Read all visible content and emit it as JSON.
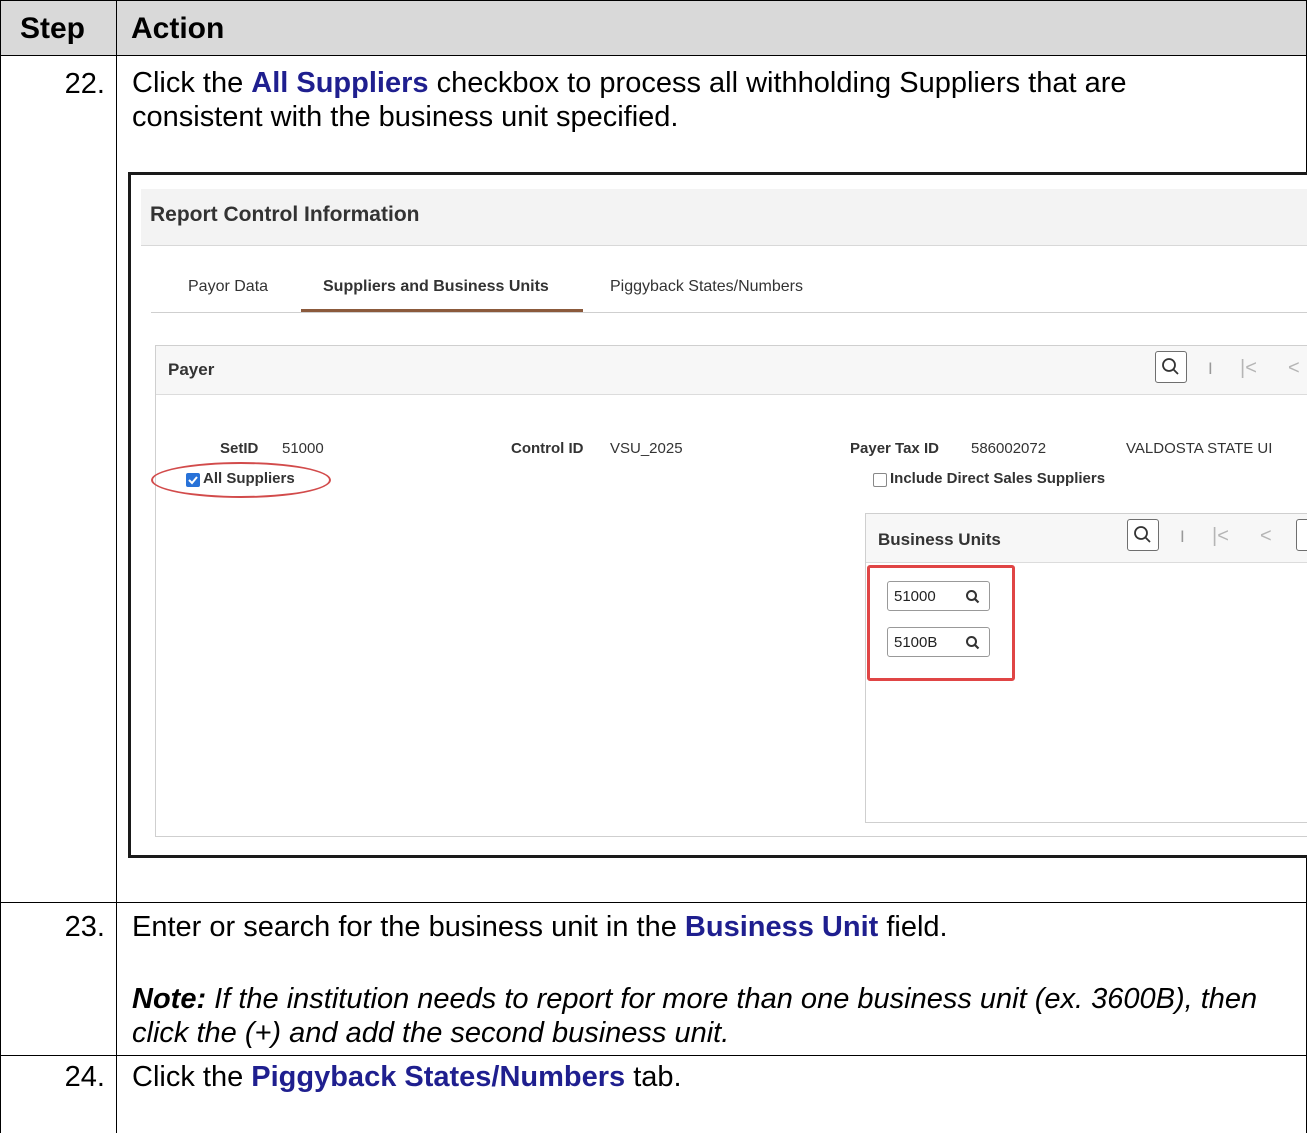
{
  "table": {
    "header": {
      "step": "Step",
      "action": "Action"
    },
    "rows": [
      {
        "step": "22.",
        "action_parts": [
          "Click the ",
          "All Suppliers",
          " checkbox to process all withholding Suppliers that are consistent with the business unit specified."
        ]
      },
      {
        "step": "23.",
        "action_parts": [
          "Enter or search for the business unit in the ",
          "Business Unit",
          " field."
        ],
        "note_label": "Note:",
        "note_text": " If the institution needs to report for more than one business unit (ex. 3600B), then click the (+) and add the second business unit."
      },
      {
        "step": "24.",
        "action_parts": [
          "Click the ",
          "Piggyback States/Numbers",
          " tab."
        ]
      }
    ]
  },
  "screenshot": {
    "page_title": "Report Control Information",
    "tabs": [
      {
        "label": "Payor Data",
        "active": false
      },
      {
        "label": "Suppliers and Business Units",
        "active": true
      },
      {
        "label": "Piggyback States/Numbers",
        "active": false
      }
    ],
    "payer": {
      "title": "Payer",
      "setid_label": "SetID",
      "setid_value": "51000",
      "control_id_label": "Control ID",
      "control_id_value": "VSU_2025",
      "payer_tax_id_label": "Payer Tax ID",
      "payer_tax_id_value": "586002072",
      "payer_name": "VALDOSTA STATE UI",
      "all_suppliers_label": "All Suppliers",
      "all_suppliers_checked": true,
      "include_direct_sales_label": "Include Direct Sales Suppliers",
      "include_direct_sales_checked": false
    },
    "business_units": {
      "title": "Business Units",
      "values": [
        "51000",
        "5100B"
      ]
    },
    "colors": {
      "highlight": "#e04545",
      "tab_underline": "#8b5a3c",
      "checkbox": "#2872d8",
      "keyword": "#1f1f8f"
    },
    "icons": [
      "search-icon",
      "first-page-icon",
      "previous-icon",
      "lookup-icon"
    ]
  }
}
